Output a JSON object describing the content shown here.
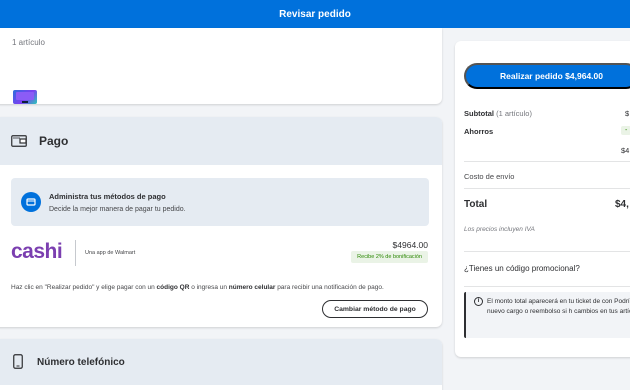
{
  "header": {
    "title": "Revisar pedido"
  },
  "items": {
    "count_label": "1 artículo"
  },
  "payment": {
    "section_title": "Pago",
    "manage_title": "Administra tus métodos de pago",
    "manage_subtitle": "Decide la mejor manera de pagar tu pedido.",
    "method_logo": "cashi",
    "method_tagline": "Una app de Walmart",
    "amount": "$4964.00",
    "reward": "Recibe 2% de bonificación",
    "instructions_prefix": "Haz clic en \"Realizar pedido\" y elige pagar con un ",
    "instructions_qr": "código QR",
    "instructions_mid": " o ingresa un ",
    "instructions_phone": "número celular",
    "instructions_suffix": " para recibir una notificación de pago.",
    "change_button": "Cambiar método de pago"
  },
  "phone": {
    "section_title": "Número telefónico"
  },
  "summary": {
    "place_order_button": "Realizar pedido $4,964.00",
    "subtotal_label": "Subtotal",
    "subtotal_count": "(1 artículo)",
    "subtotal_value": "$",
    "savings_label": "Ahorros",
    "savings_value": "-",
    "savings_value2": "$4",
    "shipping_label": "Costo de envío",
    "total_label": "Total",
    "total_value": "$4,",
    "iva_note": "Los precios incluyen IVA",
    "promo_label": "¿Tienes un código promocional?",
    "notice_text": "El monto total aparecerá en tu ticket de con Podrías ver un nuevo cargo o reembolso si h cambios en tus artículos."
  },
  "colors": {
    "primary": "#0071dc",
    "cashi": "#7b3fb0",
    "success": "#2a8703"
  }
}
